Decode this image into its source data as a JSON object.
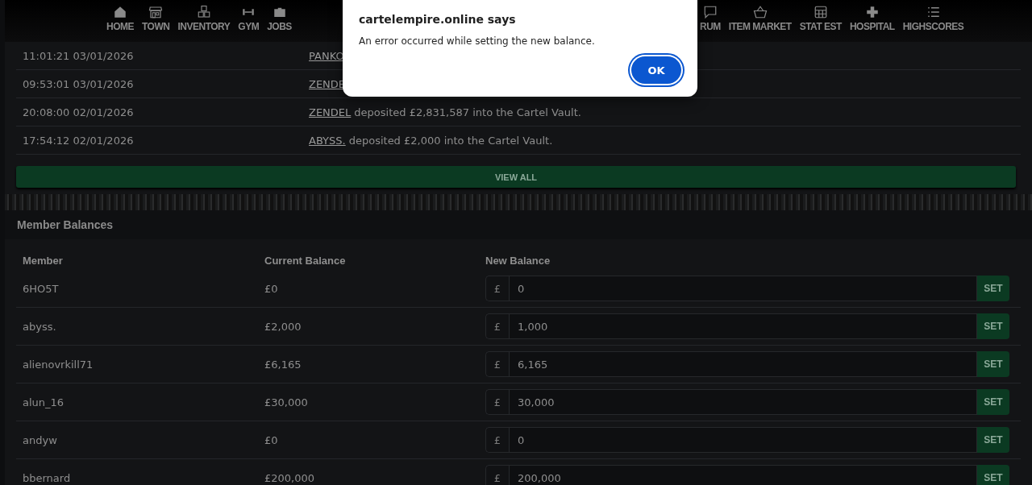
{
  "nav_left": [
    {
      "label": "HOME",
      "kind": "home"
    },
    {
      "label": "TOWN",
      "kind": "shop"
    },
    {
      "label": "INVENTORY",
      "kind": "cubes"
    },
    {
      "label": "GYM",
      "kind": "dumbbell"
    },
    {
      "label": "JOBS",
      "kind": "briefcase"
    }
  ],
  "nav_right": [
    {
      "label": "RUM",
      "kind": "chat"
    },
    {
      "label": "ITEM MARKET",
      "kind": "basket"
    },
    {
      "label": "STAT EST",
      "kind": "grid"
    },
    {
      "label": "HOSPITAL",
      "kind": "plus"
    },
    {
      "label": "HIGHSCORES",
      "kind": "list"
    }
  ],
  "log_rows": [
    {
      "time": "11:01:21 03/01/2026",
      "user": "PANKO"
    },
    {
      "time": "09:53:01 03/01/2026",
      "user": "ZENDE"
    },
    {
      "time": "20:08:00 02/01/2026",
      "user": "ZENDEL",
      "event": "deposited £2,831,587 into the Cartel Vault."
    },
    {
      "time": "17:54:12 02/01/2026",
      "user": "ABYSS.",
      "event": "deposited £2,000 into the Cartel Vault."
    }
  ],
  "view_all": "VIEW ALL",
  "balances": {
    "title": "Member Balances",
    "columns": [
      "Member",
      "Current Balance",
      "New Balance"
    ],
    "rows": [
      {
        "member": "6HO5T",
        "current": "£0",
        "currency": "£",
        "value": "0",
        "button": "SET"
      },
      {
        "member": "abyss.",
        "current": "£2,000",
        "currency": "£",
        "value": "1,000",
        "button": "SET"
      },
      {
        "member": "alienovrkill71",
        "current": "£6,165",
        "currency": "£",
        "value": "6,165",
        "button": "SET"
      },
      {
        "member": "alun_16",
        "current": "£30,000",
        "currency": "£",
        "value": "30,000",
        "button": "SET"
      },
      {
        "member": "andyw",
        "current": "£0",
        "currency": "£",
        "value": "0",
        "button": "SET"
      },
      {
        "member": "bbernard",
        "current": "£200,000",
        "currency": "£",
        "value": "200,000",
        "button": "SET"
      }
    ]
  },
  "dialog": {
    "title": "cartelempire.online says",
    "message": "An error occurred while setting the new balance.",
    "button": "OK"
  }
}
